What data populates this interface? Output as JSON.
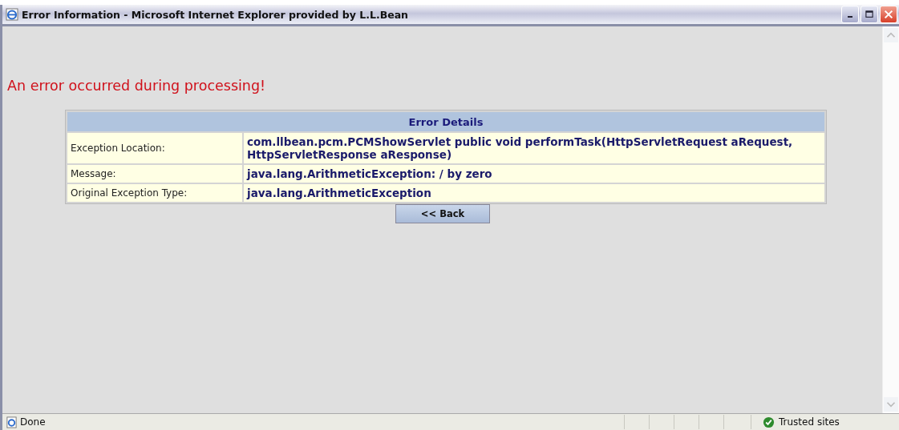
{
  "window": {
    "title": "Error Information - Microsoft Internet Explorer provided by L.L.Bean"
  },
  "heading": "An error occurred during processing!",
  "table": {
    "title": "Error Details",
    "rows": [
      {
        "label": "Exception Location:",
        "value": "com.llbean.pcm.PCMShowServlet public void performTask(HttpServletRequest aRequest, HttpServletResponse aResponse)"
      },
      {
        "label": "Message:",
        "value": "java.lang.ArithmeticException: / by zero"
      },
      {
        "label": "Original Exception Type:",
        "value": "java.lang.ArithmeticException"
      }
    ]
  },
  "back_button": "<< Back",
  "status_bar": {
    "status": "Done",
    "zone": "Trusted sites"
  }
}
